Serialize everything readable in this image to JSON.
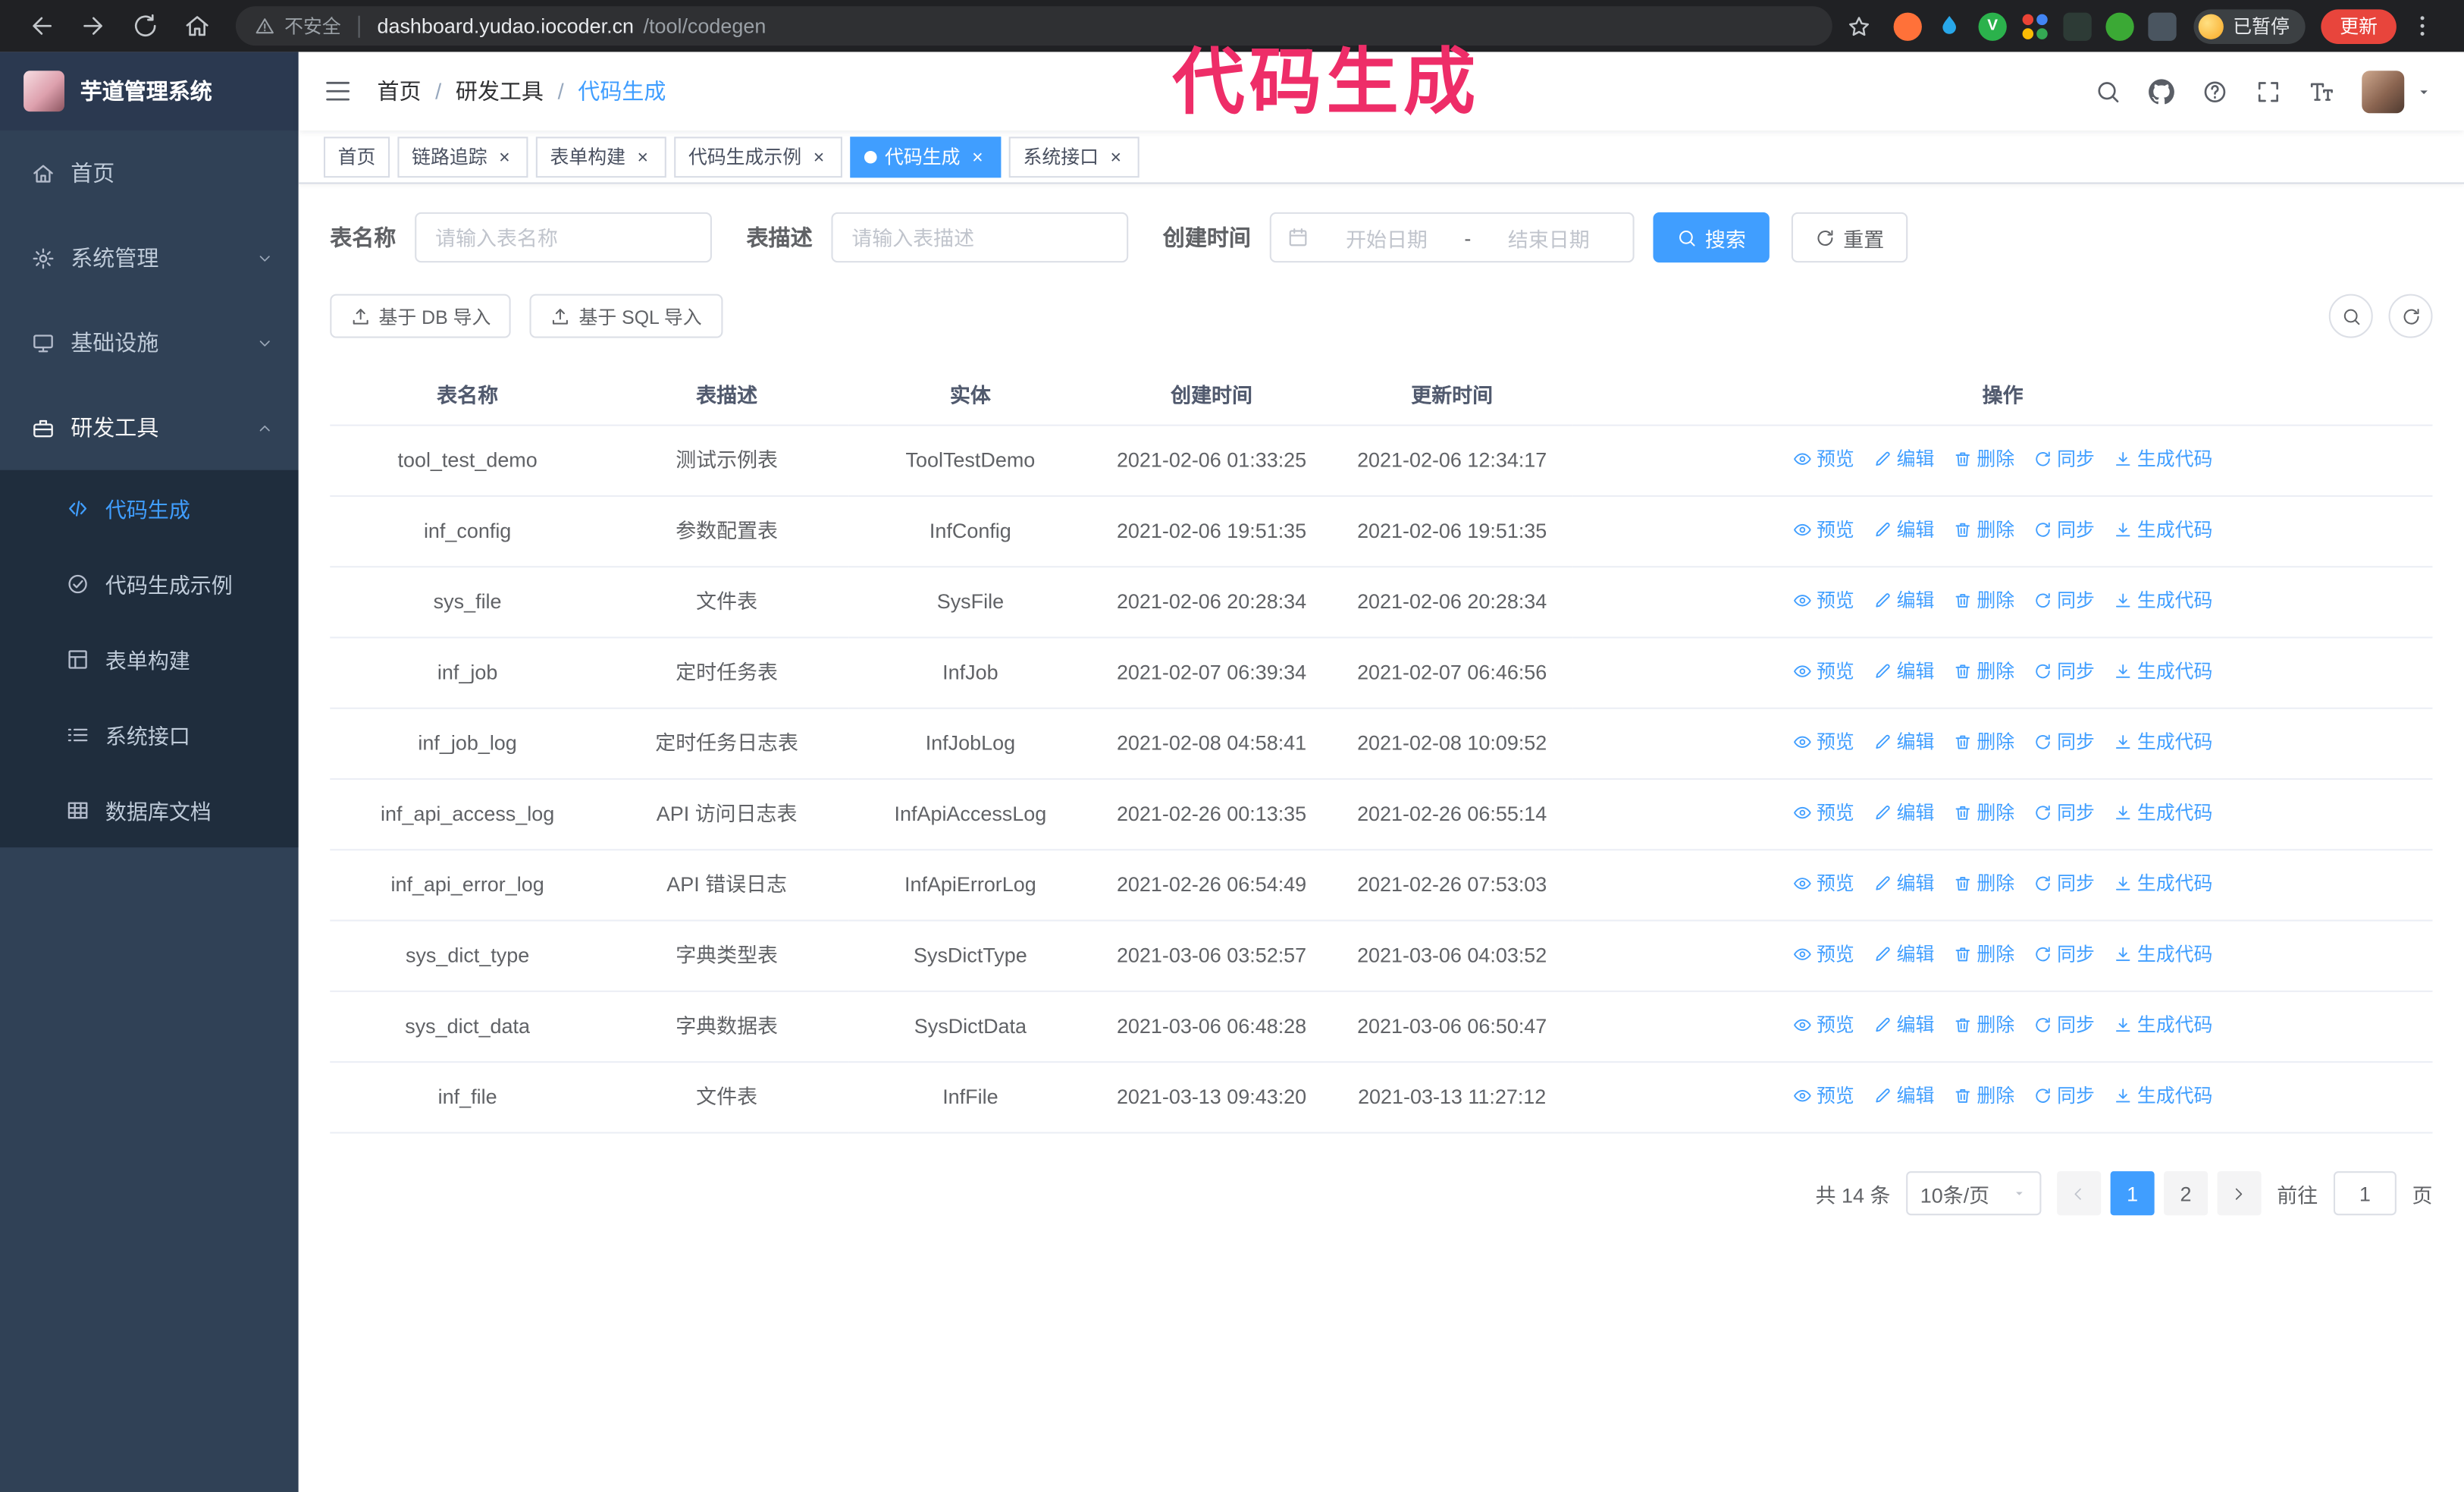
{
  "annotation": {
    "text": "代码生成"
  },
  "colors": {
    "primary": "#409EFF",
    "sidebar_bg": "#304156",
    "submenu_bg": "#1f2d3d",
    "annotation": "#ee2d68",
    "update_button": "#e8453c",
    "active_tab": "#409EFF"
  },
  "browser": {
    "security_label": "不安全",
    "url_domain": "dashboard.yudao.iocoder.cn",
    "url_path": "/tool/codegen",
    "paused_label": "已暂停",
    "update_label": "更新",
    "extensions": [
      {
        "id": "orange",
        "color": "#ff7139",
        "shape": "circle"
      },
      {
        "id": "blue-drop",
        "color": "#28a7e9",
        "shape": "drop"
      },
      {
        "id": "green-v",
        "color": "#2bb24c",
        "shape": "circle",
        "text": "V"
      },
      {
        "id": "people-grid",
        "shape": "grid"
      },
      {
        "id": "dark-green",
        "color": "#2d3b36",
        "shape": "square"
      },
      {
        "id": "leaf",
        "color": "#3ba935",
        "shape": "circle"
      },
      {
        "id": "dark-figure",
        "color": "#4a5560",
        "shape": "square"
      }
    ]
  },
  "sidebar": {
    "logo_title": "芋道管理系统",
    "menu": [
      {
        "id": "home",
        "label": "首页",
        "icon": "home"
      },
      {
        "id": "system-management",
        "label": "系统管理",
        "icon": "gear",
        "chevron": "down"
      },
      {
        "id": "infrastructure",
        "label": "基础设施",
        "icon": "monitor",
        "chevron": "down"
      },
      {
        "id": "dev-tools",
        "label": "研发工具",
        "icon": "tool",
        "chevron": "up",
        "active": true,
        "children": [
          {
            "id": "codegen",
            "label": "代码生成",
            "icon": "code",
            "active": true
          },
          {
            "id": "codegen-example",
            "label": "代码生成示例",
            "icon": "example"
          },
          {
            "id": "form-build",
            "label": "表单构建",
            "icon": "form"
          },
          {
            "id": "system-api",
            "label": "系统接口",
            "icon": "api"
          },
          {
            "id": "db-doc",
            "label": "数据库文档",
            "icon": "dbdoc"
          }
        ]
      }
    ]
  },
  "header": {
    "breadcrumb": [
      {
        "id": "home",
        "label": "首页"
      },
      {
        "id": "dev-tools",
        "label": "研发工具"
      },
      {
        "id": "codegen",
        "label": "代码生成",
        "current": true
      }
    ]
  },
  "tabs": [
    {
      "id": "home",
      "label": "首页",
      "closable": false
    },
    {
      "id": "tracing",
      "label": "链路追踪",
      "closable": true
    },
    {
      "id": "form-build",
      "label": "表单构建",
      "closable": true
    },
    {
      "id": "codegen-example",
      "label": "代码生成示例",
      "closable": true
    },
    {
      "id": "codegen",
      "label": "代码生成",
      "closable": true,
      "active": true
    },
    {
      "id": "system-api",
      "label": "系统接口",
      "closable": true
    }
  ],
  "filters": {
    "table_name_label": "表名称",
    "table_name_placeholder": "请输入表名称",
    "table_desc_label": "表描述",
    "table_desc_placeholder": "请输入表描述",
    "create_time_label": "创建时间",
    "date_start_placeholder": "开始日期",
    "date_separator": "-",
    "date_end_placeholder": "结束日期",
    "search_label": "搜索",
    "reset_label": "重置"
  },
  "toolbar": {
    "import_db_label": "基于 DB 导入",
    "import_sql_label": "基于 SQL 导入"
  },
  "table": {
    "columns": [
      "表名称",
      "表描述",
      "实体",
      "创建时间",
      "更新时间",
      "操作"
    ],
    "actions": [
      {
        "id": "preview",
        "label": "预览",
        "icon": "eye"
      },
      {
        "id": "edit",
        "label": "编辑",
        "icon": "edit"
      },
      {
        "id": "delete",
        "label": "删除",
        "icon": "trash"
      },
      {
        "id": "sync",
        "label": "同步",
        "icon": "sync"
      },
      {
        "id": "generate",
        "label": "生成代码",
        "icon": "download"
      }
    ],
    "rows": [
      {
        "name": "tool_test_demo",
        "desc": "测试示例表",
        "entity": "ToolTestDemo",
        "created": "2021-02-06 01:33:25",
        "updated": "2021-02-06 12:34:17"
      },
      {
        "name": "inf_config",
        "desc": "参数配置表",
        "entity": "InfConfig",
        "created": "2021-02-06 19:51:35",
        "updated": "2021-02-06 19:51:35"
      },
      {
        "name": "sys_file",
        "desc": "文件表",
        "entity": "SysFile",
        "created": "2021-02-06 20:28:34",
        "updated": "2021-02-06 20:28:34"
      },
      {
        "name": "inf_job",
        "desc": "定时任务表",
        "entity": "InfJob",
        "created": "2021-02-07 06:39:34",
        "updated": "2021-02-07 06:46:56"
      },
      {
        "name": "inf_job_log",
        "desc": "定时任务日志表",
        "entity": "InfJobLog",
        "created": "2021-02-08 04:58:41",
        "updated": "2021-02-08 10:09:52"
      },
      {
        "name": "inf_api_access_log",
        "desc": "API 访问日志表",
        "entity": "InfApiAccessLog",
        "created": "2021-02-26 00:13:35",
        "updated": "2021-02-26 06:55:14"
      },
      {
        "name": "inf_api_error_log",
        "desc": "API 错误日志",
        "entity": "InfApiErrorLog",
        "created": "2021-02-26 06:54:49",
        "updated": "2021-02-26 07:53:03"
      },
      {
        "name": "sys_dict_type",
        "desc": "字典类型表",
        "entity": "SysDictType",
        "created": "2021-03-06 03:52:57",
        "updated": "2021-03-06 04:03:52"
      },
      {
        "name": "sys_dict_data",
        "desc": "字典数据表",
        "entity": "SysDictData",
        "created": "2021-03-06 06:48:28",
        "updated": "2021-03-06 06:50:47"
      },
      {
        "name": "inf_file",
        "desc": "文件表",
        "entity": "InfFile",
        "created": "2021-03-13 09:43:20",
        "updated": "2021-03-13 11:27:12"
      }
    ]
  },
  "pagination": {
    "total": "共 14 条",
    "page_size": "10条/页",
    "pages": [
      "1",
      "2"
    ],
    "active_page": "1",
    "goto_label": "前往",
    "goto_value": "1",
    "goto_suffix": "页"
  }
}
